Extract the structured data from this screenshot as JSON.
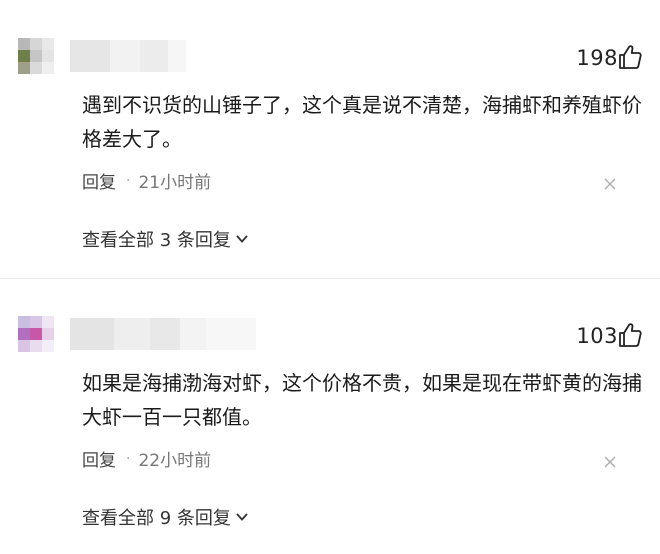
{
  "comments": [
    {
      "likes": "198",
      "text": "遇到不识货的山锤子了，这个真是说不清楚，海捕虾和养殖虾价格差大了。",
      "reply_label": "回复",
      "time": "21小时前",
      "view_all_label": "查看全部 3 条回复",
      "avatar_colors": [
        "#b8b8b8",
        "#d6d6d6",
        "#e8e8e8",
        "#6f7f49",
        "#c5c5c5",
        "#e4e4e4",
        "#9ea089",
        "#dadada",
        "#efefef"
      ]
    },
    {
      "likes": "103",
      "text": "如果是海捕渤海对虾，这个价格不贵，如果是现在带虾黄的海捕大虾一百一只都值。",
      "reply_label": "回复",
      "time": "22小时前",
      "view_all_label": "查看全部 9 条回复",
      "avatar_colors": [
        "#c9bfe0",
        "#d8c5e6",
        "#eee6f3",
        "#b36fbf",
        "#c957a8",
        "#e6d0ea",
        "#d9c4e4",
        "#e9dcee",
        "#f3eef5"
      ]
    }
  ],
  "colors": {
    "text": "#1a1a1a",
    "meta": "#777777",
    "divider": "#ececec"
  }
}
